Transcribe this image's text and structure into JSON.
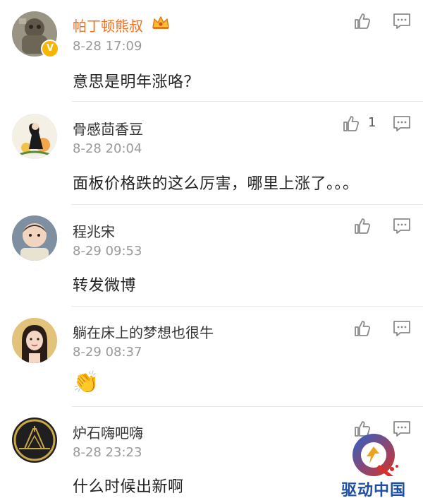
{
  "comments": [
    {
      "name": "帕丁顿熊叔",
      "time": "8-28 17:09",
      "text": "意思是明年涨咯？",
      "likes": ""
    },
    {
      "name": "骨感茴香豆",
      "time": "8-28 20:04",
      "text": "面板价格跌的这么厉害，哪里上涨了。。。",
      "likes": "1"
    },
    {
      "name": "程兆宋",
      "time": "8-29 09:53",
      "text": "转发微博",
      "likes": ""
    },
    {
      "name": "躺在床上的梦想也很牛",
      "time": "8-29 08:37",
      "text": "👏",
      "likes": ""
    },
    {
      "name": "炉石嗨吧嗨",
      "time": "8-28 23:23",
      "text": "什么时候出新啊",
      "likes": ""
    }
  ],
  "badges": {
    "verified": "V"
  },
  "watermark": {
    "text": "驱动中国"
  },
  "colors": {
    "vip_name": "#f07020",
    "name": "#333333",
    "time": "#999999",
    "icon": "#8a8a8a",
    "verified_badge": "#f7b500"
  },
  "icons": {
    "like": "thumbs-up-icon",
    "reply": "comment-icon",
    "crown": "crown-icon"
  }
}
